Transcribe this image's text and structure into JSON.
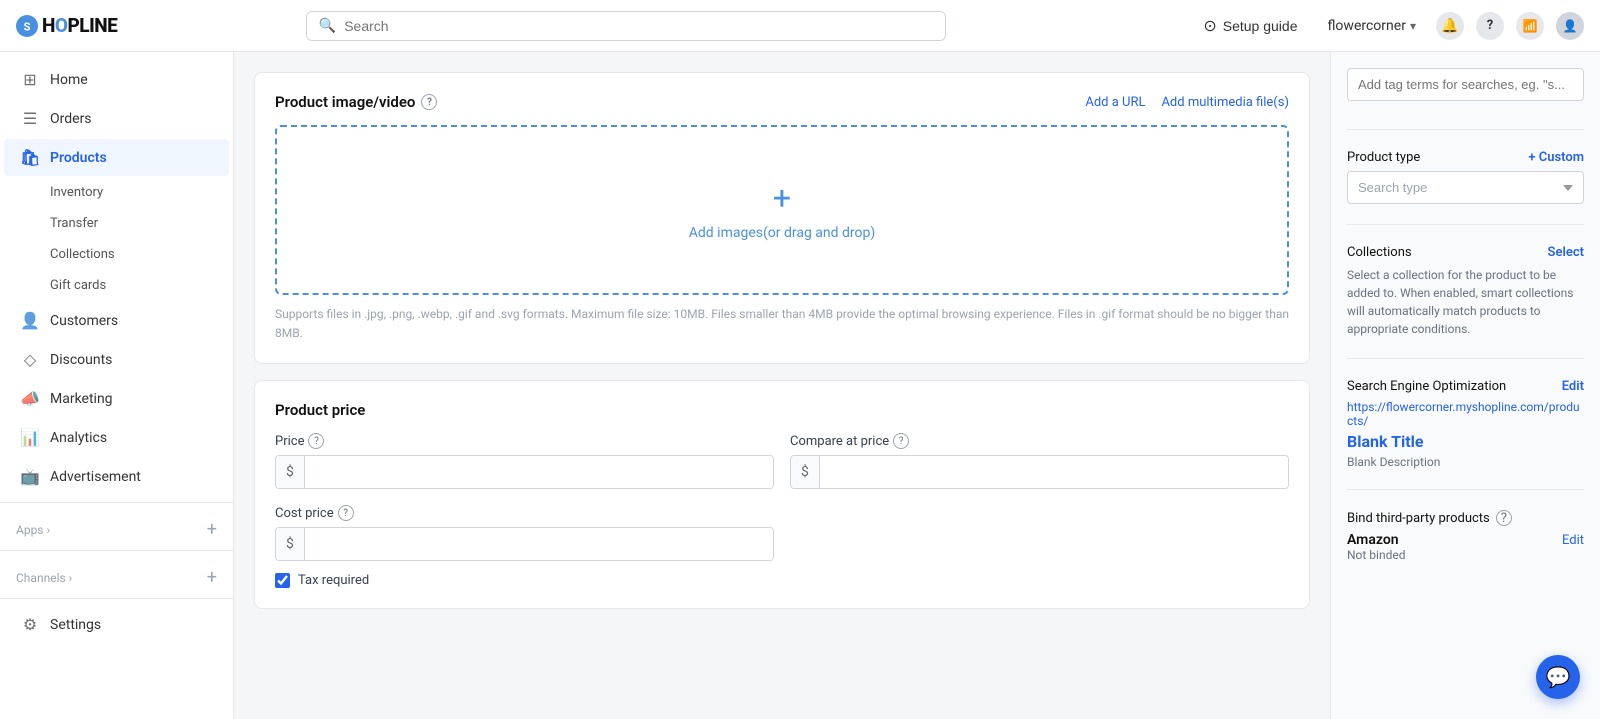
{
  "header": {
    "logo": "SHOPLINE",
    "search_placeholder": "Search",
    "setup_guide_label": "Setup guide",
    "store_name": "flowercorner",
    "icons": {
      "notification": "🔔",
      "help": "?",
      "wifi": "📶",
      "chevron": "▾"
    }
  },
  "sidebar": {
    "items": [
      {
        "id": "home",
        "label": "Home",
        "icon": "⊞"
      },
      {
        "id": "orders",
        "label": "Orders",
        "icon": "☰"
      },
      {
        "id": "products",
        "label": "Products",
        "icon": "🛍",
        "active": true
      },
      {
        "id": "customers",
        "label": "Customers",
        "icon": "👤"
      },
      {
        "id": "discounts",
        "label": "Discounts",
        "icon": "◇"
      },
      {
        "id": "marketing",
        "label": "Marketing",
        "icon": "📣"
      },
      {
        "id": "analytics",
        "label": "Analytics",
        "icon": "📊"
      },
      {
        "id": "advertisement",
        "label": "Advertisement",
        "icon": "📺"
      }
    ],
    "sub_items": [
      {
        "id": "inventory",
        "label": "Inventory"
      },
      {
        "id": "transfer",
        "label": "Transfer"
      },
      {
        "id": "collections",
        "label": "Collections"
      },
      {
        "id": "gift-cards",
        "label": "Gift cards"
      }
    ],
    "sections": [
      {
        "id": "apps",
        "label": "Apps ›",
        "add": true
      },
      {
        "id": "channels",
        "label": "Channels ›",
        "add": true
      }
    ],
    "settings_label": "Settings"
  },
  "product_image": {
    "title": "Product image/video",
    "add_url_label": "Add a URL",
    "add_multimedia_label": "Add multimedia file(s)",
    "upload_text": "Add images(or drag and drop)",
    "upload_hint": "Supports files in .jpg, .png, .webp, .gif and .svg formats. Maximum file size: 10MB. Files smaller than 4MB provide the optimal browsing experience. Files in .gif format should be no bigger than 8MB."
  },
  "product_price": {
    "title": "Product price",
    "price_label": "Price",
    "price_prefix": "$",
    "compare_price_label": "Compare at price",
    "compare_prefix": "$",
    "cost_price_label": "Cost price",
    "cost_prefix": "$",
    "tax_label": "Tax required"
  },
  "right_panel": {
    "tag_placeholder": "Add tag terms for searches, eg. \"s...",
    "product_type_label": "Product type",
    "custom_label": "+ Custom",
    "search_type_placeholder": "Search type",
    "collections_label": "Collections",
    "collections_select_label": "Select",
    "collections_hint": "Select a collection for the product to be added to. When enabled, smart collections will automatically match products to appropriate conditions.",
    "seo_label": "Search Engine Optimization",
    "seo_edit_label": "Edit",
    "seo_url": "https://flowercorner.myshopline.com/products/",
    "seo_title": "Blank Title",
    "seo_description": "Blank Description",
    "bind_label": "Bind third-party products",
    "amazon_label": "Amazon",
    "amazon_edit_label": "Edit",
    "amazon_status": "Not binded"
  }
}
